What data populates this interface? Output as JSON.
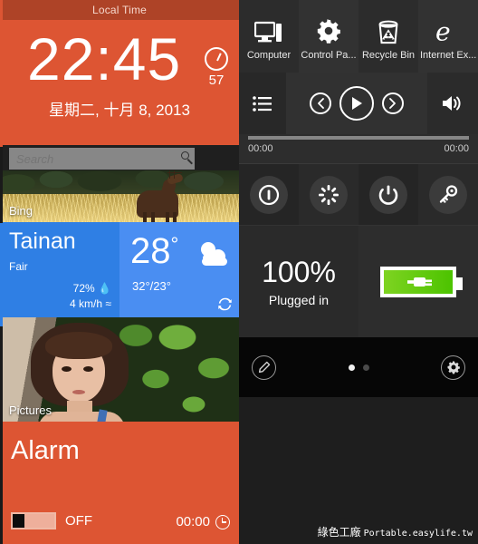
{
  "clock": {
    "header": "Local Time",
    "time": "22:45",
    "seconds": "57",
    "date": "星期二, 十月 8, 2013",
    "clock_icon": "clock-icon",
    "tile_color": "#dd5533",
    "header_color": "#ae4327"
  },
  "search": {
    "placeholder": "Search",
    "value": "",
    "icon": "search-icon"
  },
  "bing": {
    "label": "Bing"
  },
  "weather": {
    "city": "Tainan",
    "condition": "Fair",
    "humidity": "72%",
    "humidity_icon": "droplet-icon",
    "wind": "4 km/h",
    "wind_icon": "wind-icon",
    "temperature": "28",
    "degree": "°",
    "high_low": "32°/23°",
    "condition_icon": "moon-cloud-icon",
    "refresh_icon": "refresh-icon",
    "color_left": "#2f7fe4",
    "color_right": "#4a8ef2"
  },
  "pictures": {
    "label": "Pictures"
  },
  "alarm": {
    "title": "Alarm",
    "toggle_state": "OFF",
    "time": "00:00",
    "clock_icon": "clock-icon",
    "tile_color": "#dd5533"
  },
  "shortcuts": [
    {
      "label": "Computer",
      "icon": "computer-icon"
    },
    {
      "label": "Control Pa...",
      "icon": "gear-icon"
    },
    {
      "label": "Recycle Bin",
      "icon": "recycle-bin-icon"
    },
    {
      "label": "Internet Ex...",
      "icon": "internet-explorer-icon"
    }
  ],
  "media": {
    "playlist_icon": "playlist-icon",
    "prev_icon": "previous-icon",
    "play_icon": "play-icon",
    "next_icon": "next-icon",
    "volume_icon": "volume-icon",
    "elapsed": "00:00",
    "duration": "00:00",
    "progress_percent": 0
  },
  "power": [
    {
      "name": "sleep-button",
      "icon": "sleep-icon"
    },
    {
      "name": "restart-button",
      "icon": "restart-icon"
    },
    {
      "name": "shutdown-button",
      "icon": "power-icon"
    },
    {
      "name": "lock-button",
      "icon": "key-icon"
    }
  ],
  "battery": {
    "percent": "100%",
    "status": "Plugged in",
    "icon": "battery-plugged-icon",
    "fill_color": "#5ecb0b"
  },
  "toolbar": {
    "edit_icon": "pencil-icon",
    "settings_icon": "gear-icon",
    "page_dots": 2,
    "active_dot": 0
  },
  "watermark": {
    "cn": "綠色工廠",
    "en": "Portable.easylife.tw"
  }
}
